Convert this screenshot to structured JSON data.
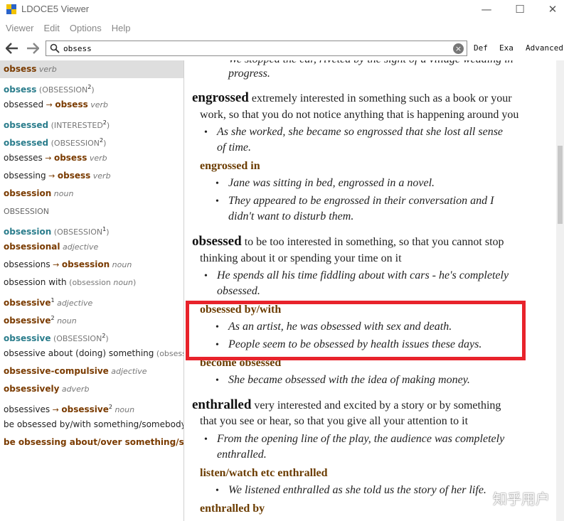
{
  "window": {
    "title": "LDOCE5 Viewer",
    "controls": [
      "—",
      "☐",
      "✕"
    ]
  },
  "menu": [
    "Viewer",
    "Edit",
    "Options",
    "Help"
  ],
  "toolbar": {
    "search_value": "obsess",
    "buttons": [
      "Def",
      "Exa",
      "Advanced"
    ]
  },
  "list": [
    {
      "parts": [
        {
          "t": "obsess",
          "c": "hw-brown"
        },
        {
          "t": " verb",
          "c": "pos"
        }
      ],
      "selected": true
    },
    {
      "parts": [
        {
          "t": "obsess",
          "c": "hw-teal"
        },
        {
          "t": " (OBSESSION",
          "c": "paren"
        },
        {
          "t": "2",
          "c": "sup"
        },
        {
          "t": ")",
          "c": "paren"
        }
      ]
    },
    {
      "parts": [
        {
          "t": "obsessed",
          "c": "plain"
        },
        {
          "t": " → ",
          "c": "arrow"
        },
        {
          "t": "obsess",
          "c": "hw-brown"
        },
        {
          "t": " verb",
          "c": "pos"
        }
      ]
    },
    {
      "parts": [
        {
          "t": "obsessed",
          "c": "hw-teal"
        },
        {
          "t": " (INTERESTED",
          "c": "paren"
        },
        {
          "t": "2",
          "c": "sup"
        },
        {
          "t": ")",
          "c": "paren"
        }
      ]
    },
    {
      "parts": [
        {
          "t": "obsessed",
          "c": "hw-teal"
        },
        {
          "t": " (OBSESSION",
          "c": "paren"
        },
        {
          "t": "2",
          "c": "sup"
        },
        {
          "t": ")",
          "c": "paren"
        }
      ]
    },
    {
      "parts": [
        {
          "t": "obsesses",
          "c": "plain"
        },
        {
          "t": " → ",
          "c": "arrow"
        },
        {
          "t": "obsess",
          "c": "hw-brown"
        },
        {
          "t": " verb",
          "c": "pos"
        }
      ]
    },
    {
      "parts": [
        {
          "t": "obsessing",
          "c": "plain"
        },
        {
          "t": " → ",
          "c": "arrow"
        },
        {
          "t": "obsess",
          "c": "hw-brown"
        },
        {
          "t": " verb",
          "c": "pos"
        }
      ]
    },
    {
      "parts": [
        {
          "t": "obsession",
          "c": "hw-brown"
        },
        {
          "t": " noun",
          "c": "pos"
        }
      ]
    },
    {
      "parts": [
        {
          "t": "OBSESSION",
          "c": "gray-cap"
        }
      ]
    },
    {
      "parts": [
        {
          "t": "obsession",
          "c": "hw-teal"
        },
        {
          "t": " (OBSESSION",
          "c": "paren"
        },
        {
          "t": "1",
          "c": "sup"
        },
        {
          "t": ")",
          "c": "paren"
        }
      ]
    },
    {
      "parts": [
        {
          "t": "obsessional",
          "c": "hw-brown"
        },
        {
          "t": " adjective",
          "c": "pos"
        }
      ]
    },
    {
      "parts": [
        {
          "t": "obsessions",
          "c": "plain"
        },
        {
          "t": " → ",
          "c": "arrow"
        },
        {
          "t": "obsession",
          "c": "hw-brown"
        },
        {
          "t": " noun",
          "c": "pos"
        }
      ]
    },
    {
      "parts": [
        {
          "t": "obsession with",
          "c": "plain"
        },
        {
          "t": " (obsession ",
          "c": "paren"
        },
        {
          "t": "noun",
          "c": "pos"
        },
        {
          "t": ")",
          "c": "paren"
        }
      ]
    },
    {
      "parts": [
        {
          "t": "obsessive",
          "c": "hw-brown"
        },
        {
          "t": "1",
          "c": "sup"
        },
        {
          "t": " adjective",
          "c": "pos"
        }
      ]
    },
    {
      "parts": [
        {
          "t": "obsessive",
          "c": "hw-brown"
        },
        {
          "t": "2",
          "c": "sup"
        },
        {
          "t": " noun",
          "c": "pos"
        }
      ]
    },
    {
      "parts": [
        {
          "t": "obsessive",
          "c": "hw-teal"
        },
        {
          "t": " (OBSESSION",
          "c": "paren"
        },
        {
          "t": "2",
          "c": "sup"
        },
        {
          "t": ")",
          "c": "paren"
        }
      ]
    },
    {
      "parts": [
        {
          "t": "obsessive about (doing) something",
          "c": "plain"
        },
        {
          "t": " (obsess",
          "c": "paren"
        }
      ]
    },
    {
      "parts": [
        {
          "t": "obsessive-compulsive",
          "c": "hw-brown"
        },
        {
          "t": " adjective",
          "c": "pos"
        }
      ]
    },
    {
      "parts": [
        {
          "t": "obsessively",
          "c": "hw-brown"
        },
        {
          "t": " adverb",
          "c": "pos"
        }
      ]
    },
    {
      "parts": [
        {
          "t": "obsessives",
          "c": "plain"
        },
        {
          "t": " → ",
          "c": "arrow"
        },
        {
          "t": "obsessive",
          "c": "hw-brown"
        },
        {
          "t": "2",
          "c": "sup"
        },
        {
          "t": " noun",
          "c": "pos"
        }
      ]
    },
    {
      "parts": [
        {
          "t": "be obsessed by/with something/somebody",
          "c": "plain"
        }
      ]
    },
    {
      "parts": [
        {
          "t": "be obsessing about/over something/some",
          "c": "hw-brown"
        }
      ]
    }
  ],
  "content": {
    "top_example_1": "We stopped the car, riveted by the sight of a village wedding in",
    "top_example_2": "progress.",
    "engrossed": {
      "hw": "engrossed",
      "def_1": " extremely interested in something such as a book or your",
      "def_2": "work, so that you do not notice anything that is happening around you",
      "ex_1a": "As she worked, she became so engrossed that she lost all sense",
      "ex_1b": "of time.",
      "sub": "engrossed in",
      "sub_ex_1": "Jane was sitting in bed, engrossed in a novel.",
      "sub_ex_2a": "They appeared to be engrossed in their conversation and I",
      "sub_ex_2b": "didn't want to disturb them."
    },
    "obsessed": {
      "hw": "obsessed",
      "def_1": " to be too interested in something, so that you cannot stop",
      "def_2": "thinking about it or spending your time on it",
      "ex_1a": "He spends all his time fiddling about with cars - he's completely",
      "ex_1b": "obsessed.",
      "sub": "obsessed by/with",
      "sub_ex_1": "As an artist, he was obsessed with sex and death.",
      "sub_ex_2": "People seem to be obsessed by health issues these days.",
      "sub2": "become obsessed",
      "sub2_ex_1": "She became obsessed with the idea of making money."
    },
    "enthralled": {
      "hw": "enthralled",
      "def_1": " very interested and excited by a story or by something",
      "def_2": "that you see or hear, so that you give all your attention to it",
      "ex_1a": "From the opening line of the play, the audience was completely",
      "ex_1b": "enthralled.",
      "sub": "listen/watch etc enthralled",
      "sub_ex_1": "We listened enthralled as she told us the story of her life.",
      "sub2": "enthralled by"
    }
  },
  "watermark": "知乎用户"
}
